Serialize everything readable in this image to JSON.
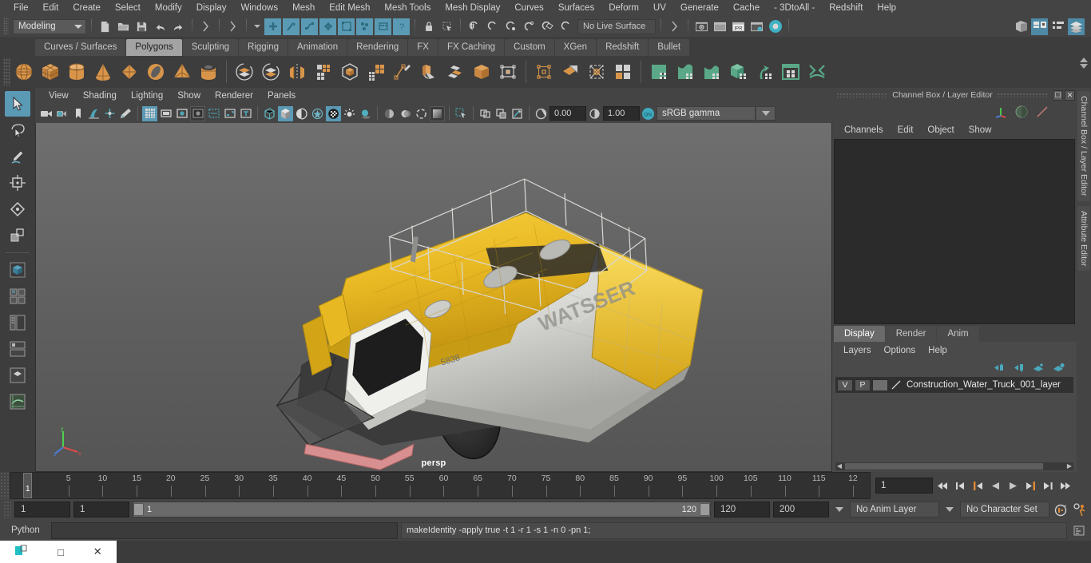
{
  "menubar": {
    "items": [
      "File",
      "Edit",
      "Create",
      "Select",
      "Modify",
      "Display",
      "Windows",
      "Mesh",
      "Edit Mesh",
      "Mesh Tools",
      "Mesh Display",
      "Curves",
      "Surfaces",
      "Deform",
      "UV",
      "Generate",
      "Cache",
      "- 3DtoAll -",
      "Redshift",
      "Help"
    ]
  },
  "statusline": {
    "menu_set": "Modeling",
    "live_surface": "No Live Surface"
  },
  "shelf_tabs": {
    "items": [
      "Curves / Surfaces",
      "Polygons",
      "Sculpting",
      "Rigging",
      "Animation",
      "Rendering",
      "FX",
      "FX Caching",
      "Custom",
      "XGen",
      "Redshift",
      "Bullet"
    ],
    "active": "Polygons"
  },
  "viewport": {
    "menus": [
      "View",
      "Shading",
      "Lighting",
      "Show",
      "Renderer",
      "Panels"
    ],
    "exposure": "0.00",
    "gamma": "1.00",
    "color_mode": "sRGB gamma",
    "camera_label": "persp",
    "axis_labels": {
      "x": "x",
      "y": "y",
      "z": "z"
    },
    "model": {
      "name": "Construction Water Truck",
      "body_text": "WATSSER",
      "tank_text": "5838"
    }
  },
  "channel_box": {
    "title": "Channel Box / Layer Editor",
    "menus": [
      "Channels",
      "Edit",
      "Object",
      "Show"
    ]
  },
  "layer_editor": {
    "tabs": [
      "Display",
      "Render",
      "Anim"
    ],
    "active_tab": "Display",
    "menus": [
      "Layers",
      "Options",
      "Help"
    ],
    "layers": [
      {
        "visibility": "V",
        "playback": "P",
        "name": "Construction_Water_Truck_001_layer"
      }
    ]
  },
  "vertical_tabs": [
    "Channel Box / Layer Editor",
    "Attribute Editor"
  ],
  "timeline": {
    "tick_labels": [
      "5",
      "10",
      "15",
      "20",
      "25",
      "30",
      "35",
      "40",
      "45",
      "50",
      "55",
      "60",
      "65",
      "70",
      "75",
      "80",
      "85",
      "90",
      "95",
      "100",
      "105",
      "110",
      "115",
      "12"
    ],
    "current_frame_marker": "1",
    "current_frame_field": "1"
  },
  "range": {
    "start": "1",
    "end": "1",
    "slider_start": "1",
    "slider_end": "120",
    "range_end": "120",
    "playback_end": "200",
    "anim_layer": "No Anim Layer",
    "character_set": "No Character Set"
  },
  "command_line": {
    "language": "Python",
    "input_value": "",
    "output": "makeIdentity -apply true -t 1 -r 1 -s 1 -n 0 -pn 1;"
  },
  "taskbar": {
    "buttons": [
      "minimize",
      "maximize",
      "close"
    ]
  },
  "colors": {
    "accent_blue": "#5b9ab5",
    "shelf_orange": "#d8954a",
    "shelf_green": "#5aa887",
    "panel_bg": "#444444",
    "dark_bg": "#2b2b2b"
  }
}
